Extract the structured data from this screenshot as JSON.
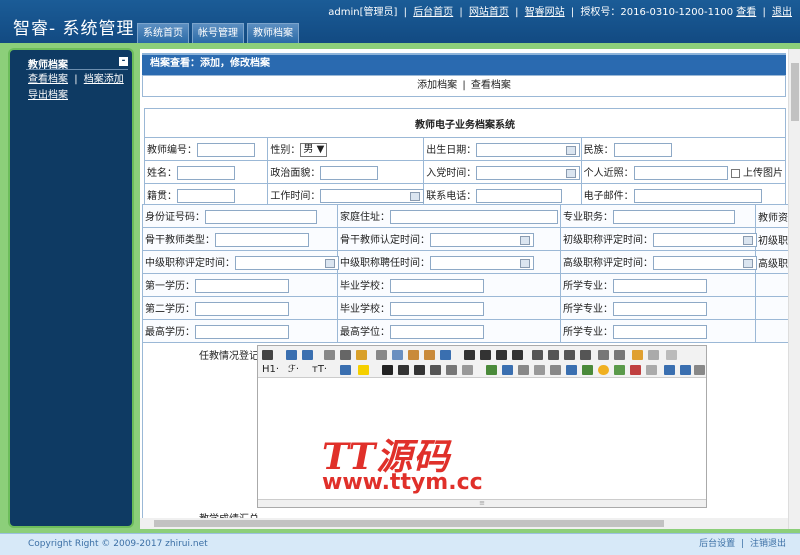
{
  "app": {
    "title": "智睿- 系统管理",
    "user_label": "admin[管理员]",
    "top_links": [
      "后台首页",
      "网站首页",
      "智睿网站"
    ],
    "license_label": "授权号：2016-0310-1200-1100",
    "license_view": "查看",
    "logout": "退出"
  },
  "tabs": [
    "系统首页",
    "帐号管理",
    "教师档案"
  ],
  "sidebar": {
    "title": "教师档案",
    "collapse": "-",
    "links": [
      "查看档案",
      "档案添加",
      "导出档案"
    ],
    "sep": "|"
  },
  "main": {
    "crumb": "档案查看：添加，修改档案",
    "actions": [
      "添加档案",
      "查看档案"
    ],
    "actions_sep": "|",
    "form_title": "教师电子业务档案系统",
    "gender_value": "男",
    "upload_label": "上传图片"
  },
  "fields1": [
    [
      "教师编号：",
      "性别：",
      "出生日期：",
      "民族："
    ],
    [
      "姓名：",
      "政治面貌：",
      "入党时间：",
      "个人近照："
    ],
    [
      "籍贯：",
      "工作时间：",
      "联系电话：",
      "电子邮件："
    ]
  ],
  "fields2": [
    [
      "身份证号码：",
      "家庭住址：",
      "专业职务：",
      "教师资格证"
    ],
    [
      "骨干教师类型：",
      "骨干教师认定时间：",
      "初级职称评定时间：",
      "初级职称聘"
    ],
    [
      "中级职称评定时间：",
      "中级职称聘任时间：",
      "高级职称评定时间：",
      "高级职称聘"
    ],
    [
      "第一学历：",
      "毕业学校：",
      "所学专业：",
      ""
    ],
    [
      "第二学历：",
      "毕业学校：",
      "所学专业：",
      ""
    ],
    [
      "最高学历：",
      "最高学位：",
      "所学专业：",
      ""
    ]
  ],
  "editor": {
    "label": "任教情况登记",
    "next_label": "教学成绩汇总",
    "heading_btn": "H1·",
    "font_btn": "ℱ·",
    "size_btn": "тT·"
  },
  "watermark": {
    "title": "TT源码",
    "url": "www.ttym.cc"
  },
  "footer": {
    "copyright": "Copyright Right © 2009-2017 zhirui.net",
    "links": [
      "后台设置",
      "注销退出"
    ],
    "sep": "|"
  },
  "colors": {
    "header": "#1b5c97",
    "sidebar": "#0e3a63",
    "frame": "#8ccf7a",
    "crumb": "#2a6ab0",
    "watermark": "#e0302a"
  }
}
